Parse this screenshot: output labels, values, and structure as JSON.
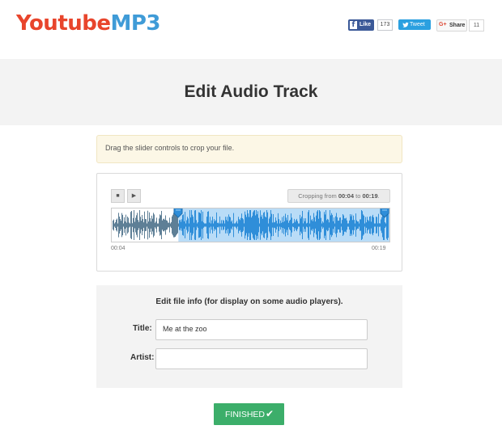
{
  "header": {
    "logo_part1": "Youtube",
    "logo_part2": "MP3",
    "fb_like_label": "Like",
    "fb_like_count": "173",
    "tweet_label": "Tweet",
    "gplus_label": "Share",
    "gplus_count": "11",
    "fb_icon": "f",
    "gplus_icon": "G+"
  },
  "page_title": "Edit Audio Track",
  "alert_text": "Drag the slider controls to crop your file.",
  "editor": {
    "stop_icon": "■",
    "play_icon": "▶",
    "crop_prefix": "Cropping from ",
    "crop_start": "00:04",
    "crop_mid": " to ",
    "crop_end": "00:19",
    "crop_suffix": ".",
    "time_start": "00:04",
    "time_end": "00:19",
    "selection_start_fraction": 0.24,
    "selection_end_fraction": 1.0
  },
  "file_info": {
    "heading": "Edit file info (for display on some audio players).",
    "title_label": "Title:",
    "title_value": "Me at the zoo",
    "artist_label": "Artist:",
    "artist_value": ""
  },
  "finish_button": {
    "label": "FINISHED",
    "icon": "✔"
  },
  "colors": {
    "brand_red": "#e8452c",
    "brand_blue": "#3f9bd7",
    "wave_selected": "#2f8ed9",
    "wave_unselected": "#5e7f96",
    "selection_bg": "#b9dcf7",
    "finish_green": "#3cae6a"
  }
}
